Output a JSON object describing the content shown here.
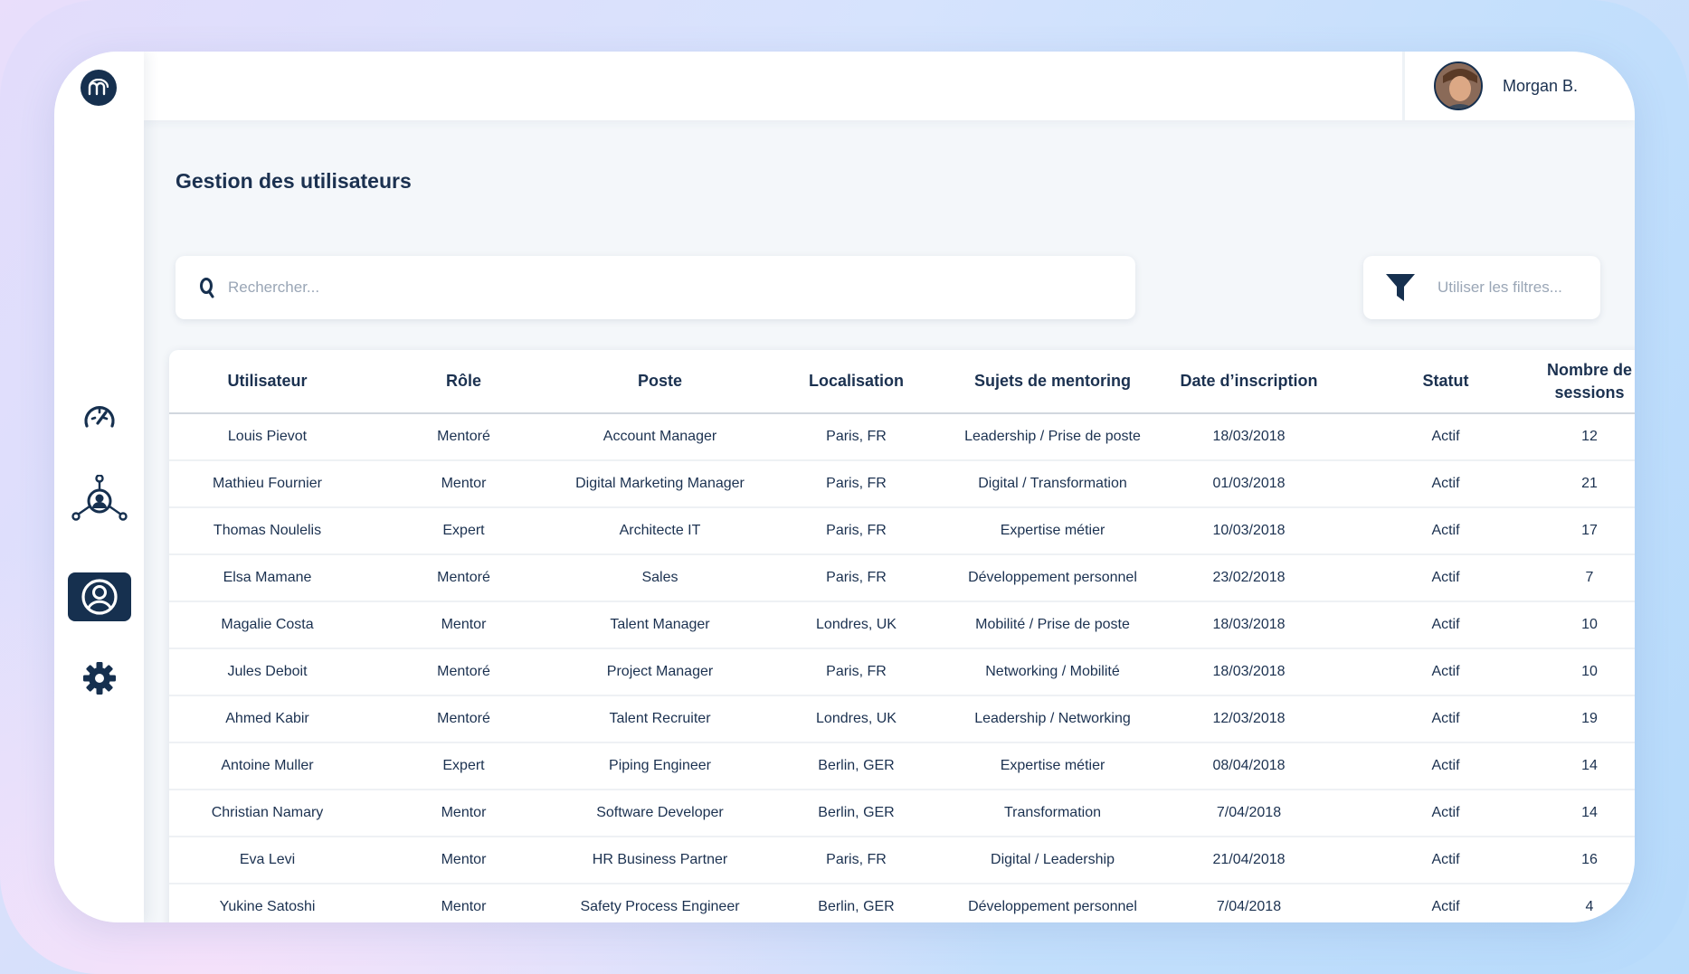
{
  "header": {
    "user_name": "Morgan B."
  },
  "page": {
    "title": "Gestion des utilisateurs"
  },
  "search": {
    "placeholder": "Rechercher..."
  },
  "filter": {
    "label": "Utiliser les filtres..."
  },
  "sidebar": {
    "items": [
      {
        "name": "dashboard",
        "icon": "speedometer-icon"
      },
      {
        "name": "network",
        "icon": "network-icon"
      },
      {
        "name": "users",
        "icon": "user-circle-icon",
        "active": true
      },
      {
        "name": "settings",
        "icon": "gear-icon"
      }
    ]
  },
  "table": {
    "columns": [
      "Utilisateur",
      "Rôle",
      "Poste",
      "Localisation",
      "Sujets de mentoring",
      "Date d’inscription",
      "Statut",
      "Nombre de sessions"
    ],
    "rows": [
      [
        "Louis Pievot",
        "Mentoré",
        "Account Manager",
        "Paris, FR",
        "Leadership / Prise de poste",
        "18/03/2018",
        "Actif",
        "12"
      ],
      [
        "Mathieu Fournier",
        "Mentor",
        "Digital Marketing Manager",
        "Paris, FR",
        "Digital / Transformation",
        "01/03/2018",
        "Actif",
        "21"
      ],
      [
        "Thomas Noulelis",
        "Expert",
        "Architecte IT",
        "Paris, FR",
        "Expertise métier",
        "10/03/2018",
        "Actif",
        "17"
      ],
      [
        "Elsa Mamane",
        "Mentoré",
        "Sales",
        "Paris, FR",
        "Développement personnel",
        "23/02/2018",
        "Actif",
        "7"
      ],
      [
        "Magalie Costa",
        "Mentor",
        "Talent Manager",
        "Londres, UK",
        "Mobilité / Prise de poste",
        "18/03/2018",
        "Actif",
        "10"
      ],
      [
        "Jules Deboit",
        "Mentoré",
        "Project Manager",
        "Paris, FR",
        "Networking / Mobilité",
        "18/03/2018",
        "Actif",
        "10"
      ],
      [
        "Ahmed Kabir",
        "Mentoré",
        "Talent Recruiter",
        "Londres, UK",
        "Leadership / Networking",
        "12/03/2018",
        "Actif",
        "19"
      ],
      [
        "Antoine Muller",
        "Expert",
        "Piping Engineer",
        "Berlin, GER",
        "Expertise métier",
        "08/04/2018",
        "Actif",
        "14"
      ],
      [
        "Christian Namary",
        "Mentor",
        "Software Developer",
        "Berlin, GER",
        "Transformation",
        "7/04/2018",
        "Actif",
        "14"
      ],
      [
        "Eva Levi",
        "Mentor",
        "HR Business Partner",
        "Paris, FR",
        "Digital / Leadership",
        "21/04/2018",
        "Actif",
        "16"
      ],
      [
        "Yukine Satoshi",
        "Mentor",
        "Safety Process Engineer",
        "Berlin, GER",
        "Développement personnel",
        "7/04/2018",
        "Actif",
        "4"
      ]
    ]
  },
  "colors": {
    "primary": "#16304f",
    "background": "#f4f7fa"
  }
}
